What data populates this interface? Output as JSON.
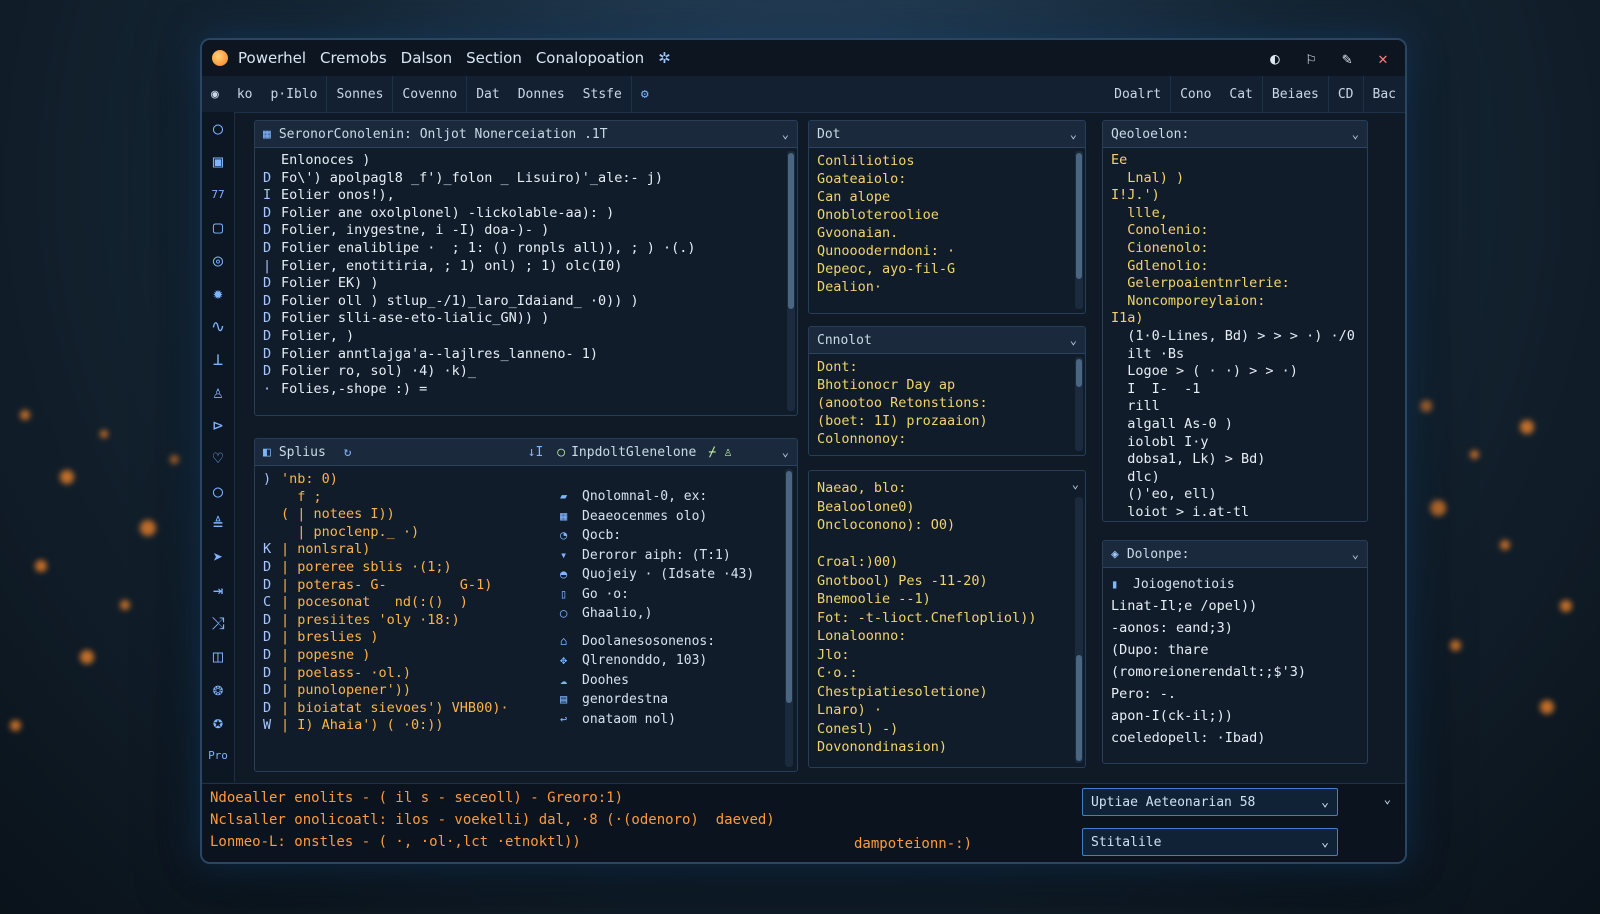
{
  "titlebar": {
    "menus": [
      "Powerhel",
      "Cremobs",
      "Dalson",
      "Section",
      "Conalopoation"
    ],
    "right_icons": [
      "moon-icon",
      "flag-icon",
      "edit-icon",
      "close-icon"
    ]
  },
  "toolbar": {
    "left": [
      "ko",
      "p·Iblo",
      "Sonnes",
      "Covenno",
      "Dat",
      "Donnes",
      "Stsfe"
    ],
    "right": [
      "Doalrt",
      "Cono",
      "Cat",
      "Beiaes",
      "CD",
      "Bac"
    ]
  },
  "editor": {
    "title": "SeronorConolenin: Onljot Nonerceiation .1T",
    "lines": [
      {
        "g": "",
        "t": "Enlonoces )"
      },
      {
        "g": "D",
        "t": "Fo\\') apolpagl8 _f')_folon _ Lisuiro)'_ale:- j)"
      },
      {
        "g": "I",
        "t": "Eolier onos!),"
      },
      {
        "g": "D",
        "t": "Folier ane oxolplonel) -lickolable-aa): )"
      },
      {
        "g": "D",
        "t": "Folier, inygestne, i -I) doa-)- )"
      },
      {
        "g": "D",
        "t": "Folier enaliblipe ·  ; 1: () ronpls all)), ; ) ·(.)"
      },
      {
        "g": "|",
        "t": "Folier, enotitiria, ; 1) onl) ; 1) olc(I0)"
      },
      {
        "g": "D",
        "t": "Folier EK) )"
      },
      {
        "g": "D",
        "t": "Folier oll ) stlup_-/1)_laro_Idaiand_ ·0)) )"
      },
      {
        "g": "D",
        "t": "Folier slli-ase-eto-lialic_GN)) )"
      },
      {
        "g": "D",
        "t": "Folier, )"
      },
      {
        "g": "D",
        "t": "Folier anntlajga'a--lajlres_lanneno- 1)"
      },
      {
        "g": "D",
        "t": "Folier ro, sol) ·4) ·k)_"
      },
      {
        "g": "·",
        "t": "Folies,-shope :) ="
      }
    ]
  },
  "explorer": {
    "title": "Splius",
    "lines": [
      {
        "g": ")",
        "t": "'nb: 0)"
      },
      {
        "g": "",
        "t": "  f ;"
      },
      {
        "g": "",
        "t": "( | notees I))"
      },
      {
        "g": "",
        "t": "  | pnoclenp._ ·)"
      },
      {
        "g": "K",
        "t": "| nonlsral)"
      },
      {
        "g": "D",
        "t": "| poreree sblis ·(1;)"
      },
      {
        "g": "D",
        "t": "| poteras- G-         G-1)"
      },
      {
        "g": "C",
        "t": "| pocesonat   nd(:()  )"
      },
      {
        "g": "D",
        "t": "| presiites 'oly ·18:)"
      },
      {
        "g": "D",
        "t": "| breslies )"
      },
      {
        "g": "D",
        "t": "| popesne )"
      },
      {
        "g": "D",
        "t": "| poelass- ·ol.)"
      },
      {
        "g": "D",
        "t": "| punolopener'))"
      },
      {
        "g": "D",
        "t": "| bioiatat sievoes') VHB00)·"
      },
      {
        "g": "W",
        "t": "| I) Ahaia') ( ·0:))"
      }
    ]
  },
  "outline": {
    "title": "InpdoltGlenelone",
    "items": [
      {
        "icon": "folder-icon",
        "t": "Qnolomnal-0, ex:"
      },
      {
        "icon": "grid-icon",
        "t": "Deaeocenmes olo)"
      },
      {
        "icon": "doc-icon",
        "t": "Qocb:"
      },
      {
        "icon": "funnel-icon",
        "t": "Deroror aiph: (T:1)"
      },
      {
        "icon": "shield-icon",
        "t": "Quojeiy · (Idsate ·43)"
      },
      {
        "icon": "file-icon",
        "t": "Go ·o:"
      },
      {
        "icon": "circle-icon",
        "t": "Ghaalio,)"
      },
      {
        "icon": "tag-icon",
        "t": "Doolanesosonenos:"
      },
      {
        "icon": "gear-icon",
        "t": "Qlrenonddo, 103)"
      },
      {
        "icon": "cloud-icon",
        "t": "Doohes"
      },
      {
        "icon": "book-icon",
        "t": "genordestna"
      },
      {
        "icon": "return-icon",
        "t": "onataom nol)"
      }
    ]
  },
  "panel_a": {
    "title": "Dot",
    "lines": [
      "Conliliotios",
      "Goateaiolo:",
      "Can alope",
      "Onobloteroolioe",
      "Gvoonaian.",
      "Qunoooderndoni: ·",
      "Depeoc, ayo-fil-G",
      "Dealion·"
    ]
  },
  "panel_b": {
    "title": "Cnnolot",
    "lines": [
      "Dont:",
      "Bhotionocr Day ap",
      "(anootoo Retonstions:",
      "(boet: 1I) prozaaion)",
      "Colonnonoy:"
    ]
  },
  "panel_c": {
    "lines": [
      "Naeao, blo:",
      "Bealoolone0)",
      "Oncloconono): O0)",
      "",
      "Croal:)00)",
      "Gnotbool) Pes -11-20)",
      "Bnemoolie --1)",
      "Fot: -t-lioct.Cneflopliol))",
      "Lonaloonno:",
      "Jlo:",
      "C·o.:",
      "Chestpiatiesoletione)",
      "Lnaro) ·",
      "Conesl) -)",
      "Dovonondinasion)"
    ]
  },
  "panel_d": {
    "title": "Qeoloelon:",
    "lines": [
      "Ee",
      "  Lnal) )",
      "I!J.')",
      "  llle,",
      "  Conolenio:",
      "  Cionenolo:",
      "  Gdlenolio:",
      "  Gelerpoaientnrlerie:",
      "  Noncomporeylaion:",
      "I1a)",
      "  (1·0-Lines, Bd) > > > ·) ·/0",
      "  ilt ·Bs",
      "  Logoe > ( · ·) > > ·)",
      "  I  I-  -1",
      "  rill",
      "  algall As-0 )",
      "  iolobl I·y",
      "  dobsa1, Lk) > Bd)",
      "  dlc)",
      "  ()'eo, ell)",
      "  loiot > i.at-tl"
    ]
  },
  "panel_e": {
    "title": "Dolonpe:",
    "subtitle": "Joiogenotiois",
    "lines": [
      "Linat-Il;e /opel))",
      "-aonos: eand;3)",
      "(Dupo: thare",
      "(romoreionerendalt:;$'3)",
      "Pero: -.",
      "apon-I(ck-il;))",
      "coeledopell: ·Ibad)"
    ]
  },
  "console": {
    "lines": [
      "Ndoealler enolits - ( il s - seceoll) - Greoro:1)",
      "Nclsaller onolicoatl: ilos - voekelli) dal, ·8 (·(odenoro)  daeved)",
      "Lonmeo-L: onstles - ( ·, ·ol·,lct ·etnoktl))"
    ],
    "status": "dampoteionn-:)"
  },
  "dropdowns": {
    "top": "Uptiae Aeteonarian 58",
    "bottom": "Stitalile"
  },
  "sidebar": {
    "icons": [
      "circle-icon",
      "image-icon",
      "counter-icon",
      "square-icon",
      "target-icon",
      "gear-icon",
      "wave-icon",
      "bars-icon",
      "user-icon",
      "tag-icon",
      "heart-icon",
      "ring-icon",
      "stack-icon",
      "play-icon",
      "arrow-icon",
      "shuffle-icon",
      "panel-icon",
      "globe-icon",
      "aperture-icon",
      "more-icon"
    ],
    "counter": "77",
    "more": "Pro"
  }
}
